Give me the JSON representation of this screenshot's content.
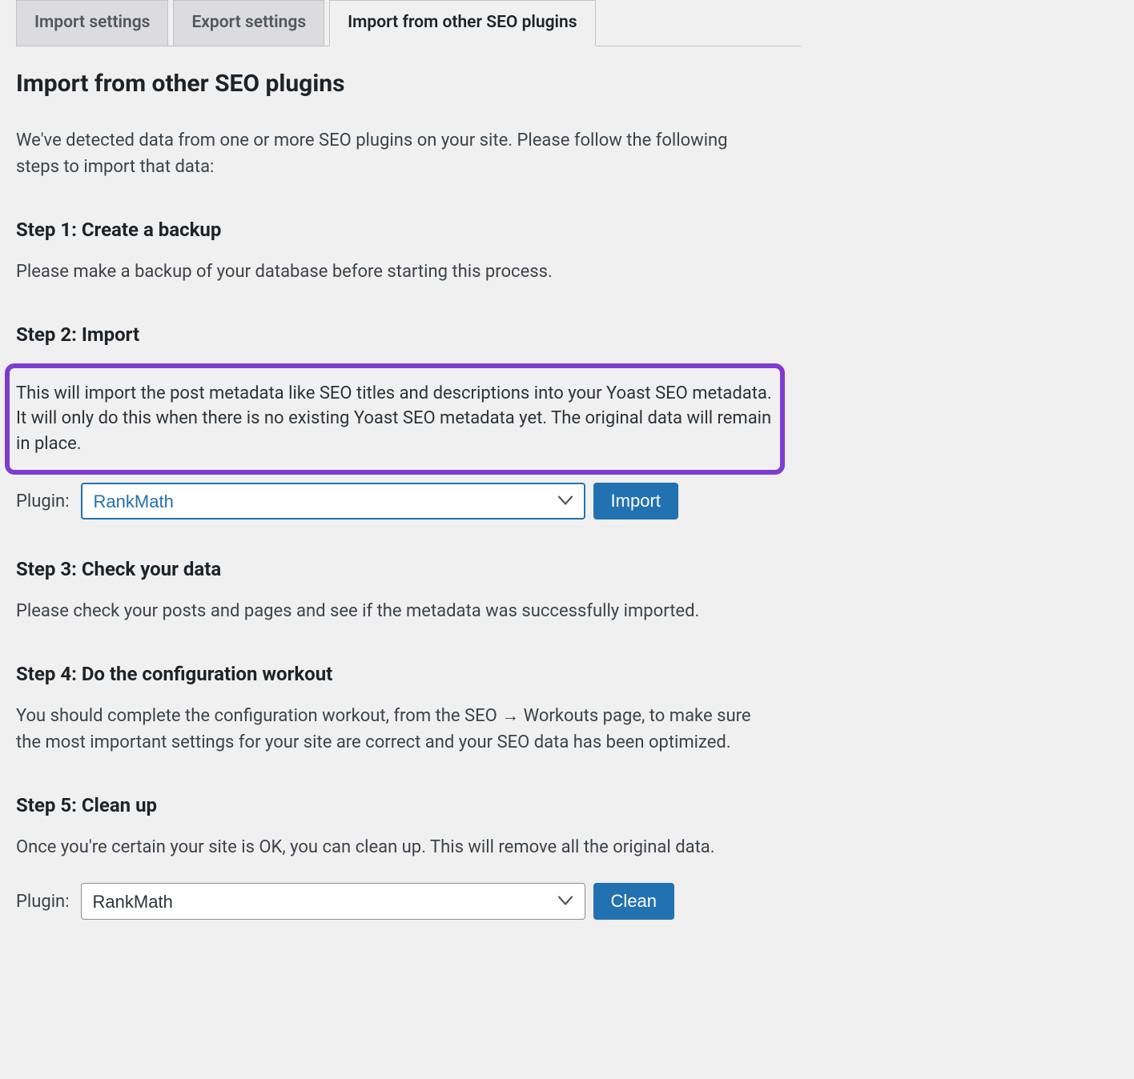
{
  "tabs": {
    "import_settings": "Import settings",
    "export_settings": "Export settings",
    "import_from_plugins": "Import from other SEO plugins"
  },
  "heading": "Import from other SEO plugins",
  "intro": "We've detected data from one or more SEO plugins on your site. Please follow the following steps to import that data:",
  "step1": {
    "title": "Step 1: Create a backup",
    "text": "Please make a backup of your database before starting this process."
  },
  "step2": {
    "title": "Step 2: Import",
    "highlight": "This will import the post metadata like SEO titles and descriptions into your Yoast SEO metadata. It will only do this when there is no existing Yoast SEO metadata yet. The original data will remain in place.",
    "plugin_label": "Plugin:",
    "selected_plugin": "RankMath",
    "import_button": "Import"
  },
  "step3": {
    "title": "Step 3: Check your data",
    "text": "Please check your posts and pages and see if the metadata was successfully imported."
  },
  "step4": {
    "title": "Step 4: Do the configuration workout",
    "text": "You should complete the configuration workout, from the SEO → Workouts page, to make sure the most important settings for your site are correct and your SEO data has been optimized."
  },
  "step5": {
    "title": "Step 5: Clean up",
    "text": "Once you're certain your site is OK, you can clean up. This will remove all the original data.",
    "plugin_label": "Plugin:",
    "selected_plugin": "RankMath",
    "clean_button": "Clean"
  }
}
